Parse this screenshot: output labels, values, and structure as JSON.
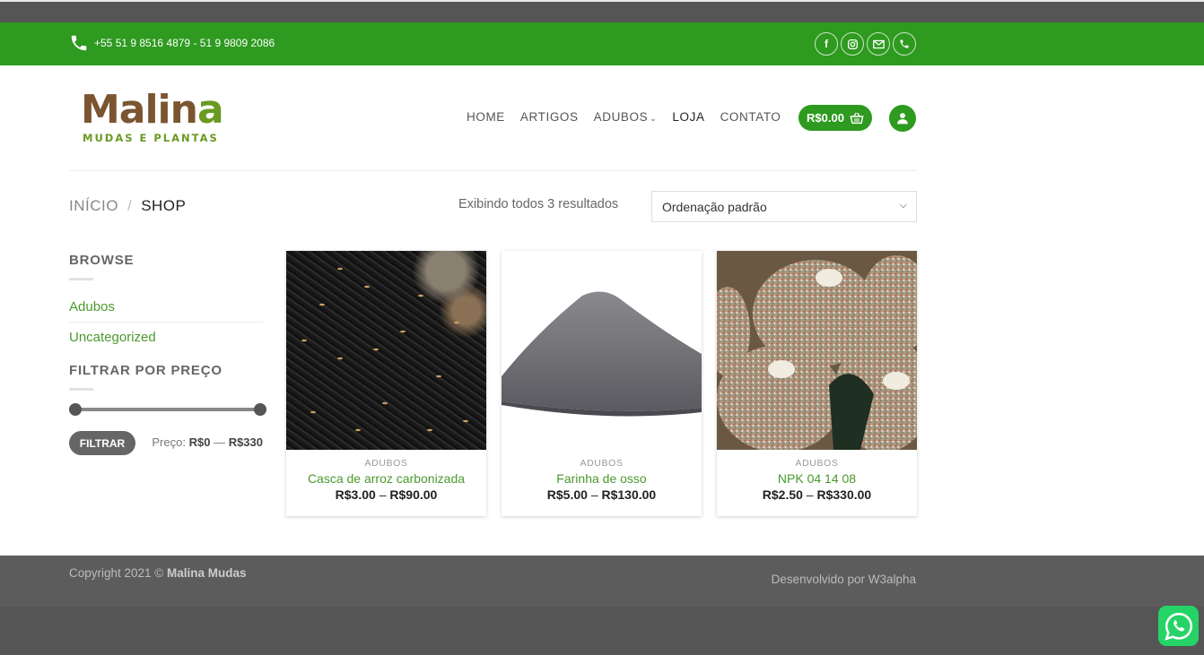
{
  "topbar": {
    "phone": "+55 51 9 8516 4879 - 51 9 9809 2086",
    "social_icons": [
      "facebook-icon",
      "instagram-icon",
      "email-icon",
      "phone-icon"
    ]
  },
  "logo": {
    "name_left": "Malin",
    "name_right": "a",
    "tagline": "MUDAS E PLANTAS"
  },
  "nav": {
    "items": [
      "HOME",
      "ARTIGOS",
      "ADUBOS",
      "LOJA",
      "CONTATO"
    ],
    "cart_total": "R$0.00"
  },
  "breadcrumb": {
    "home": "INÍCIO",
    "separator": "/",
    "current": "SHOP"
  },
  "results_text": "Exibindo todos 3 resultados",
  "sort": {
    "selected": "Ordenação padrão"
  },
  "sidebar": {
    "browse_title": "BROWSE",
    "categories": [
      "Adubos",
      "Uncategorized"
    ],
    "filter_title": "FILTRAR POR PREÇO",
    "filter_button": "FILTRAR",
    "price_label": "Preço:",
    "price_min": "R$0",
    "price_dash": "—",
    "price_max": "R$330"
  },
  "products": [
    {
      "category": "ADUBOS",
      "name": "Casca de arroz carbonizada",
      "price_low": "R$3.00",
      "price_high": "R$90.00"
    },
    {
      "category": "ADUBOS",
      "name": "Farinha de osso",
      "price_low": "R$5.00",
      "price_high": "R$130.00"
    },
    {
      "category": "ADUBOS",
      "name": "NPK 04 14 08",
      "price_low": "R$2.50",
      "price_high": "R$330.00"
    }
  ],
  "footer": {
    "copyright_prefix": "Copyright 2021 ©",
    "copyright_brand": "Malina Mudas",
    "developer": "Desenvolvido por W3alpha"
  },
  "colors": {
    "brand_green": "#2e9a1f",
    "link_green": "#4a9a2d",
    "logo_brown": "#7a5530"
  }
}
